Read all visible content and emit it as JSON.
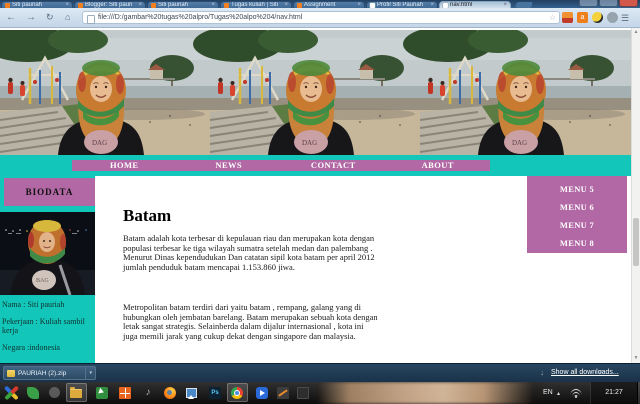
{
  "colors": {
    "teal_background": "#12c7ba",
    "purple_accent": "#b168a5",
    "chrome_frame_blue": "#33618f",
    "toolbar_blue": "#cfdeed",
    "download_bar_navy": "#1e3850",
    "taskbar_black": "#161616"
  },
  "glyphs": {
    "back": "←",
    "forward": "→",
    "reload": "↻",
    "home": "⌂",
    "star": "☆",
    "menu": "☰",
    "close": "×",
    "caret_down": "▾",
    "arrow_down": "↓",
    "scroll_up": "▲",
    "scroll_down": "▼",
    "music": "♪",
    "ps": "Ps",
    "tray_expand": "▴",
    "ext_a": "a"
  },
  "browser": {
    "tabs": [
      {
        "label": "Siti pauriah"
      },
      {
        "label": "Blogger: Siti pauri"
      },
      {
        "label": "Siti pauriah"
      },
      {
        "label": "Tugas kuliah | Siti"
      },
      {
        "label": "Assignment"
      },
      {
        "label": "Profil Siti Pauriah"
      },
      {
        "label": "nav.html"
      }
    ],
    "address": {
      "url": "file:///D:/gambar%20tugas%20alpro/Tugas%20alpo%204/nav.html"
    }
  },
  "page": {
    "nav": {
      "items": [
        "HOME",
        "NEWS",
        "CONTACT",
        "ABOUT"
      ]
    },
    "biodata": {
      "title": "BIODATA",
      "lines": [
        "Nama : Siti pauriah",
        "Pekerjaan : Kuliah sambil kerja",
        "Negara :indonesia"
      ]
    },
    "article": {
      "heading": "Batam",
      "paragraphs": [
        "Batam adalah kota terbesar di kepulauan riau dan merupakan kota dengan populasi terbesar ke tiga wilayah sumatra setelah medan dan palembang . Menurut Dinas kependudukan Dan catatan sipil kota batam per april 2012 jumlah penduduk batam mencapai 1.153.860 jiwa.",
        "Metropolitan batam terdiri dari yaitu batam , rempang, galang yang di hubungkan oleh jembatan barelang. Batam merupakan sebuah kota dengan letak sangat strategis. Selainberda dalam dijalur internasional , kota ini juga memili jarak yang cukup dekat dengan singapore dan malaysia."
      ]
    },
    "menu": {
      "items": [
        "MENU 5",
        "MENU 6",
        "MENU 7",
        "MENU 8"
      ]
    }
  },
  "downloads": {
    "file_name": "PAURIAH (2).zip",
    "show_all": "Show all downloads..."
  },
  "taskbar": {
    "tray": {
      "language": "EN",
      "time": "21:27"
    }
  }
}
